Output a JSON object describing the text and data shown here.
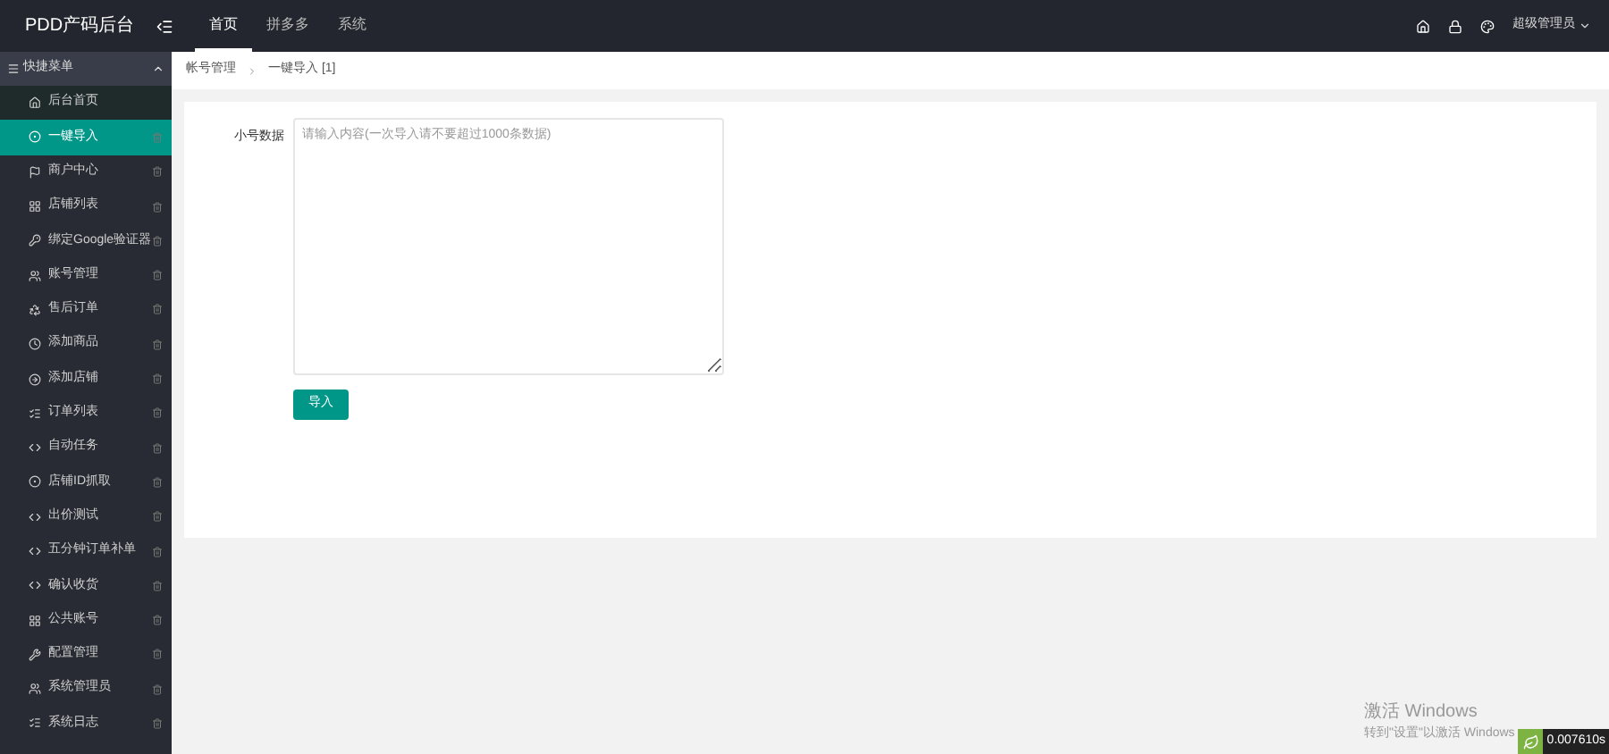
{
  "app_title": "PDD产码后台",
  "top_tabs": [
    {
      "label": "首页",
      "selected": true
    },
    {
      "label": "拼多多",
      "selected": false
    },
    {
      "label": "系统",
      "selected": false
    }
  ],
  "user_menu": {
    "label": "超级管理员"
  },
  "sidebar": {
    "header": {
      "label": "快捷菜单",
      "expanded": true
    },
    "items": [
      {
        "label": "后台首页",
        "kind": "home",
        "selected": false,
        "removable": false
      },
      {
        "label": "一键导入",
        "kind": "g",
        "selected": true,
        "removable": true
      },
      {
        "label": "商户中心",
        "kind": "flag",
        "selected": false,
        "removable": true
      },
      {
        "label": "店铺列表",
        "kind": "grid",
        "selected": false,
        "removable": true
      },
      {
        "label": "绑定Google验证器",
        "kind": "key",
        "selected": false,
        "removable": true
      },
      {
        "label": "账号管理",
        "kind": "users",
        "selected": false,
        "removable": true
      },
      {
        "label": "售后订单",
        "kind": "recycle",
        "selected": false,
        "removable": true
      },
      {
        "label": "添加商品",
        "kind": "clock",
        "selected": false,
        "removable": true
      },
      {
        "label": "添加店铺",
        "kind": "arrow",
        "selected": false,
        "removable": true
      },
      {
        "label": "订单列表",
        "kind": "list",
        "selected": false,
        "removable": true
      },
      {
        "label": "自动任务",
        "kind": "code",
        "selected": false,
        "removable": true
      },
      {
        "label": "店铺ID抓取",
        "kind": "g",
        "selected": false,
        "removable": true
      },
      {
        "label": "出价测试",
        "kind": "code",
        "selected": false,
        "removable": true
      },
      {
        "label": "五分钟订单补单",
        "kind": "code",
        "selected": false,
        "removable": true
      },
      {
        "label": "确认收货",
        "kind": "code",
        "selected": false,
        "removable": true
      },
      {
        "label": "公共账号",
        "kind": "grid",
        "selected": false,
        "removable": true
      },
      {
        "label": "配置管理",
        "kind": "wrench",
        "selected": false,
        "removable": true
      },
      {
        "label": "系统管理员",
        "kind": "users",
        "selected": false,
        "removable": true
      },
      {
        "label": "系统日志",
        "kind": "list",
        "selected": false,
        "removable": true
      }
    ]
  },
  "breadcrumb": [
    {
      "label": "帐号管理"
    },
    {
      "label": "一键导入 [1]"
    }
  ],
  "form": {
    "label": "小号数据",
    "placeholder": "请输入内容(一次导入请不要超过1000条数据)",
    "button": "导入"
  },
  "activation_notice": {
    "title": "激活 Windows",
    "text": "转到\"设置\"以激活 Windows"
  },
  "timer_badge": "0.007610s"
}
